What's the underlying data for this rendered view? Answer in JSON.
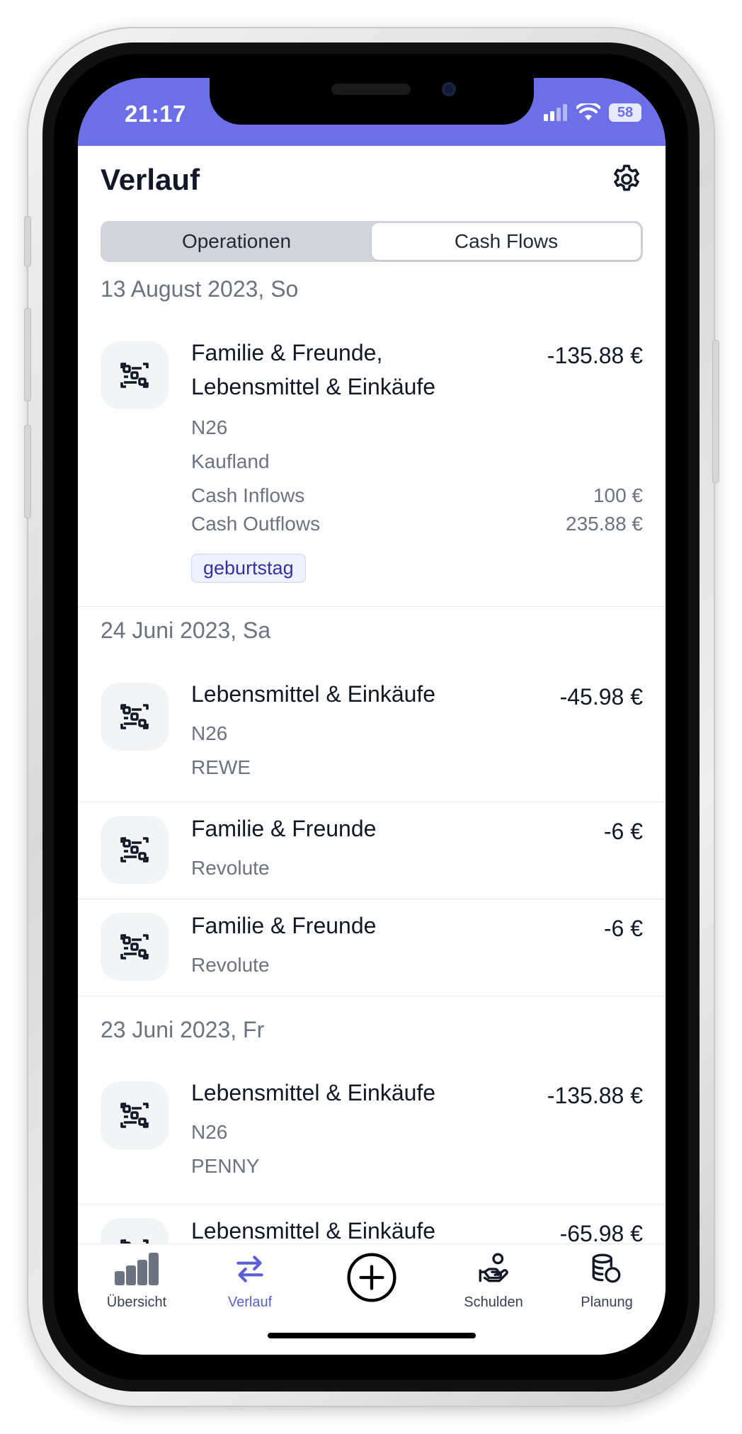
{
  "status": {
    "time": "21:17",
    "battery": "58"
  },
  "header": {
    "title": "Verlauf"
  },
  "segments": {
    "operations": "Operationen",
    "cash_flows": "Cash Flows"
  },
  "groups": [
    {
      "date": "13 August 2023, So"
    },
    {
      "date": "24 Juni 2023, Sa"
    },
    {
      "date": "23 Juni 2023, Fr"
    }
  ],
  "tx1": {
    "title_line1": "Familie & Freunde,",
    "title_line2": "Lebensmittel & Einkäufe",
    "amount": "-135.88 €",
    "account": "N26",
    "merchant": "Kaufland",
    "inflows_label": "Cash Inflows",
    "inflows_value": "100 €",
    "outflows_label": "Cash Outflows",
    "outflows_value": "235.88 €",
    "tag": "geburtstag"
  },
  "tx2": {
    "title": "Lebensmittel & Einkäufe",
    "amount": "-45.98 €",
    "account": "N26",
    "merchant": "REWE"
  },
  "tx3": {
    "title": "Familie & Freunde",
    "amount": "-6 €",
    "account": "Revolute"
  },
  "tx4": {
    "title": "Familie & Freunde",
    "amount": "-6 €",
    "account": "Revolute"
  },
  "tx5": {
    "title": "Lebensmittel & Einkäufe",
    "amount": "-135.88 €",
    "account": "N26",
    "merchant": "PENNY"
  },
  "tx6": {
    "title": "Lebensmittel & Einkäufe",
    "amount": "-65.98 €"
  },
  "tabbar": {
    "overview": "Übersicht",
    "history": "Verlauf",
    "debts": "Schulden",
    "planning": "Planung"
  },
  "colors": {
    "accent": "#6b70e8",
    "active_tab": "#5b5fd6"
  }
}
